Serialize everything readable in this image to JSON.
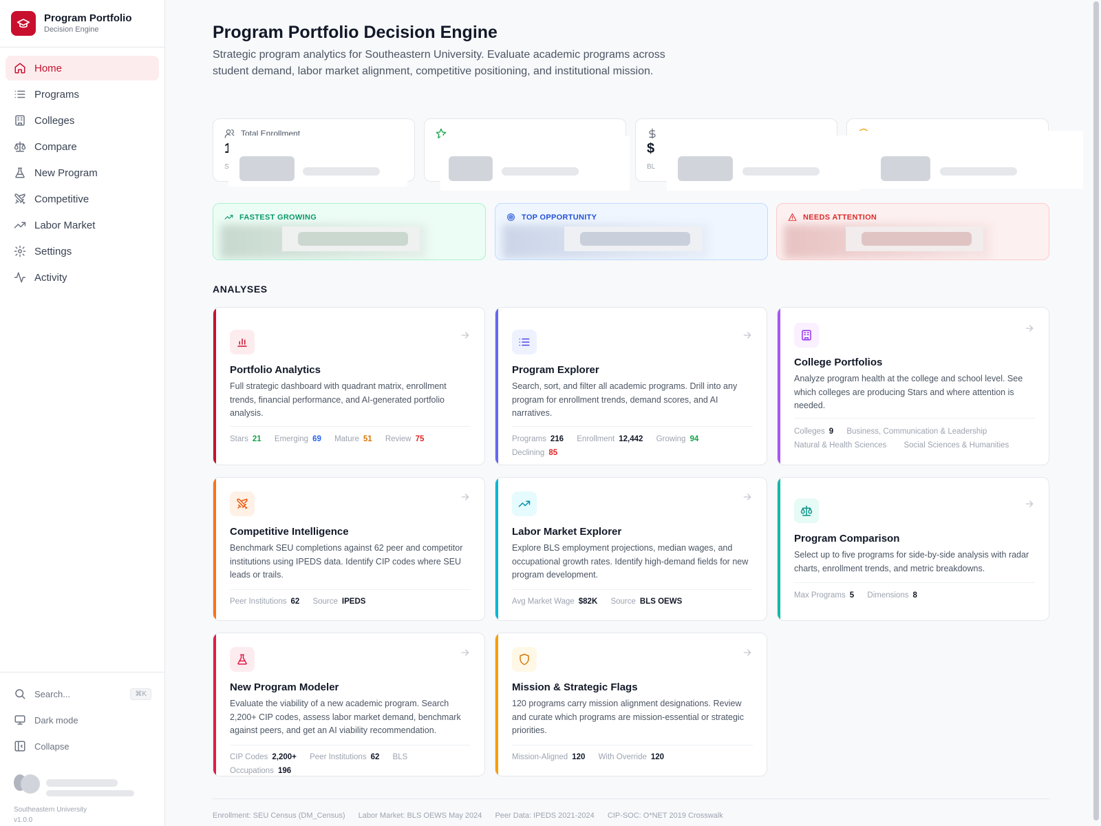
{
  "brand": {
    "title": "Program Portfolio",
    "subtitle": "Decision Engine"
  },
  "nav": [
    {
      "label": "Home",
      "icon": "home-icon",
      "active": true
    },
    {
      "label": "Programs",
      "icon": "list-icon"
    },
    {
      "label": "Colleges",
      "icon": "building-icon"
    },
    {
      "label": "Compare",
      "icon": "scale-icon"
    },
    {
      "label": "New Program",
      "icon": "flask-icon"
    },
    {
      "label": "Competitive",
      "icon": "swords-icon"
    },
    {
      "label": "Labor Market",
      "icon": "trending-up-icon"
    },
    {
      "label": "Settings",
      "icon": "gear-icon"
    },
    {
      "label": "Activity",
      "icon": "activity-icon"
    }
  ],
  "sidebar_bottom": {
    "search_label": "Search...",
    "search_shortcut": "⌘K",
    "dark_mode_label": "Dark mode",
    "collapse_label": "Collapse",
    "org_name": "Southeastern University",
    "version": "v1.0.0"
  },
  "header": {
    "title": "Program Portfolio Decision Engine",
    "description": "Strategic program analytics for Southeastern University. Evaluate academic programs across student demand, labor market alignment, competitive positioning, and institutional mission."
  },
  "stats": {
    "total_enrollment": {
      "label": "Total Enrollment",
      "value_partial": "1",
      "sub_partial": "Sp"
    },
    "card2": {
      "value_partial": "★"
    },
    "card3": {
      "value_partial": "$",
      "sub_partial": "BL"
    }
  },
  "insights": {
    "fastest_growing": "FASTEST GROWING",
    "top_opportunity": "TOP OPPORTUNITY",
    "needs_attention": "NEEDS ATTENTION"
  },
  "section_title": "ANALYSES",
  "cards": {
    "portfolio_analytics": {
      "title": "Portfolio Analytics",
      "description": "Full strategic dashboard with quadrant matrix, enrollment trends, financial performance, and AI-generated portfolio analysis.",
      "stats": [
        {
          "k": "Stars",
          "v": "21"
        },
        {
          "k": "Emerging",
          "v": "69"
        },
        {
          "k": "Mature",
          "v": "51"
        },
        {
          "k": "Review",
          "v": "75"
        }
      ]
    },
    "program_explorer": {
      "title": "Program Explorer",
      "description": "Search, sort, and filter all academic programs. Drill into any program for enrollment trends, demand scores, and AI narratives.",
      "stats": [
        {
          "k": "Programs",
          "v": "216"
        },
        {
          "k": "Enrollment",
          "v": "12,442"
        },
        {
          "k": "Growing",
          "v": "94"
        },
        {
          "k": "Declining",
          "v": "85"
        }
      ]
    },
    "college_portfolios": {
      "title": "College Portfolios",
      "description": "Analyze program health at the college and school level. See which colleges are producing Stars and where attention is needed.",
      "colleges_label": "Colleges",
      "colleges_value": "9",
      "college_names": [
        "Business, Communication & Leadership",
        "Natural & Health Sciences",
        "Social Sciences & Humanities"
      ]
    },
    "competitive_intelligence": {
      "title": "Competitive Intelligence",
      "description": "Benchmark SEU completions against 62 peer and competitor institutions using IPEDS data. Identify CIP codes where SEU leads or trails.",
      "stats": [
        {
          "k": "Peer Institutions",
          "v": "62"
        },
        {
          "k": "Source",
          "v": "IPEDS"
        }
      ]
    },
    "labor_market_explorer": {
      "title": "Labor Market Explorer",
      "description": "Explore BLS employment projections, median wages, and occupational growth rates. Identify high-demand fields for new program development.",
      "stats": [
        {
          "k": "Avg Market Wage",
          "v": "$82K"
        },
        {
          "k": "Source",
          "v": "BLS OEWS"
        }
      ]
    },
    "program_comparison": {
      "title": "Program Comparison",
      "description": "Select up to five programs for side-by-side analysis with radar charts, enrollment trends, and metric breakdowns.",
      "stats": [
        {
          "k": "Max Programs",
          "v": "5"
        },
        {
          "k": "Dimensions",
          "v": "8"
        }
      ]
    },
    "new_program_modeler": {
      "title": "New Program Modeler",
      "description": "Evaluate the viability of a new academic program. Search 2,200+ CIP codes, assess labor market demand, benchmark against peers, and get an AI viability recommendation.",
      "stats": [
        {
          "k": "CIP Codes",
          "v": "2,200+"
        },
        {
          "k": "Peer Institutions",
          "v": "62"
        },
        {
          "k": "BLS Occupations",
          "v": "196"
        }
      ]
    },
    "mission_flags": {
      "title": "Mission & Strategic Flags",
      "description": "120 programs carry mission alignment designations. Review and curate which programs are mission-essential or strategic priorities.",
      "stats": [
        {
          "k": "Mission-Aligned",
          "v": "120"
        },
        {
          "k": "With Override",
          "v": "120"
        }
      ]
    }
  },
  "footer": [
    "Enrollment: SEU Census (DM_Census)",
    "Labor Market: BLS OEWS May 2024",
    "Peer Data: IPEDS 2021-2024",
    "CIP-SOC: O*NET 2019 Crosswalk"
  ],
  "colors": {
    "brand": "#c8102e",
    "stars": "#16a34a",
    "emerging": "#2563eb",
    "mature": "#d97706",
    "review": "#dc2626"
  }
}
